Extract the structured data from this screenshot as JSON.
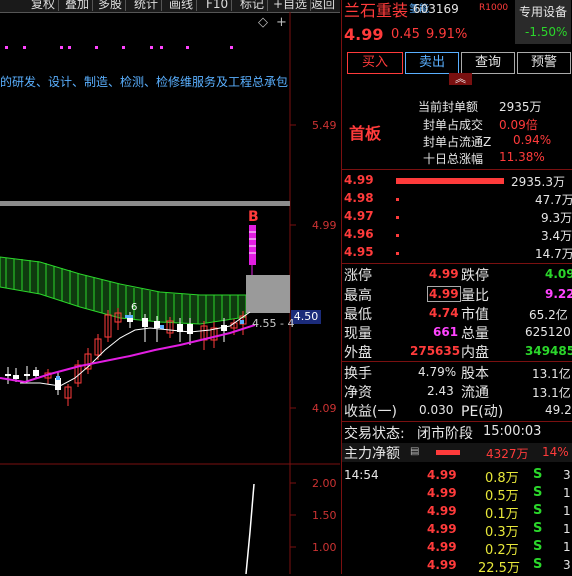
{
  "toolbar": {
    "items": [
      "复权",
      "叠加",
      "多股",
      "统计",
      "画线",
      "F10",
      "标记",
      "+自选",
      "返回"
    ]
  },
  "chart": {
    "description": "的研发、设计、制造、检测、检修维服务及工程总承包",
    "price_labels": [
      "5.49",
      "4.99",
      "4.50",
      "4.09"
    ],
    "current_price_tag": "4.50",
    "range_note": "4.55 - 4",
    "signal_letter": "B",
    "marker_text": "6",
    "indicator_labels": [
      "2.00",
      "1.50",
      "1.00"
    ]
  },
  "stock": {
    "name": "兰石重装",
    "tag": "氢能",
    "code": "603169",
    "badge": "R1000",
    "device_label": "专用设备",
    "device_change": "-1.50%",
    "price": "4.99",
    "change": "0.45",
    "change_pct": "9.91%"
  },
  "actions": {
    "buy": "买入",
    "sell": "卖出",
    "query": "查询",
    "alert": "预警"
  },
  "limit_info": {
    "badge": "首板",
    "rows": [
      {
        "label": "当前封单额",
        "value": "2935万"
      },
      {
        "label": "封单占成交",
        "value": "0.09倍"
      },
      {
        "label": "封单占流通Z",
        "value": "0.94%"
      },
      {
        "label": "十日总涨幅",
        "value": "11.38%"
      }
    ]
  },
  "order_book": [
    {
      "price": "4.99",
      "vol": "2935.3万"
    },
    {
      "price": "4.98",
      "vol": "47.7万"
    },
    {
      "price": "4.97",
      "vol": "9.3万"
    },
    {
      "price": "4.96",
      "vol": "3.4万"
    },
    {
      "price": "4.95",
      "vol": "14.7万"
    }
  ],
  "stats": {
    "limit_up_label": "涨停",
    "limit_up": "4.99",
    "limit_down_label": "跌停",
    "limit_down": "4.09",
    "high_label": "最高",
    "high": "4.99",
    "vol_ratio_label": "量比",
    "vol_ratio": "9.22",
    "low_label": "最低",
    "low": "4.74",
    "mkt_cap_label": "市值",
    "mkt_cap": "65.2亿",
    "vol_label": "现量",
    "vol": "661",
    "total_vol_label": "总量",
    "total_vol": "625120",
    "outer_label": "外盘",
    "outer": "275635",
    "inner_label": "内盘",
    "inner": "349485",
    "turnover_label": "换手",
    "turnover": "4.79%",
    "shares_label": "股本",
    "shares": "13.1亿",
    "nav_label": "净资",
    "nav": "2.43",
    "float_label": "流通",
    "float": "13.1亿",
    "eps_label": "收益(一)",
    "eps": "0.030",
    "pe_label": "PE(动)",
    "pe": "49.2"
  },
  "trade_status": {
    "label": "交易状态:",
    "value": "闭市阶段",
    "time": "15:00:03"
  },
  "net_flow": {
    "label": "主力净额",
    "value": "4327万",
    "pct": "14%"
  },
  "ticks": [
    {
      "time": "14:54",
      "price": "4.99",
      "vol": "0.8万",
      "side": "S",
      "n": "3"
    },
    {
      "time": "",
      "price": "4.99",
      "vol": "0.5万",
      "side": "S",
      "n": "1"
    },
    {
      "time": "",
      "price": "4.99",
      "vol": "0.1万",
      "side": "S",
      "n": "1"
    },
    {
      "time": "",
      "price": "4.99",
      "vol": "0.3万",
      "side": "S",
      "n": "1"
    },
    {
      "time": "",
      "price": "4.99",
      "vol": "0.2万",
      "side": "S",
      "n": "1"
    },
    {
      "time": "",
      "price": "4.99",
      "vol": "22.5万",
      "side": "S",
      "n": "3"
    }
  ],
  "colors": {
    "up": "#ff3b3b",
    "down": "#2bd62b",
    "magenta": "#ff44ff",
    "cloud": "#1f7a1f"
  }
}
